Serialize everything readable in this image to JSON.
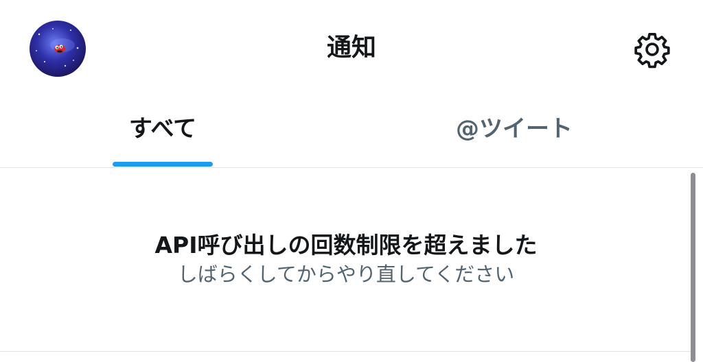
{
  "header": {
    "title": "通知",
    "avatar_icon": "avatar-icon",
    "settings_icon": "gear-icon"
  },
  "tabs": [
    {
      "label": "すべて",
      "active": true
    },
    {
      "label": "@ツイート",
      "active": false
    }
  ],
  "message": {
    "title": "API呼び出しの回数制限を超えました",
    "body": "しばらくしてからやり直してください"
  },
  "colors": {
    "accent": "#1d9bf0",
    "text_primary": "#14171a",
    "text_secondary": "#536471",
    "divider": "#dfe3e8"
  }
}
